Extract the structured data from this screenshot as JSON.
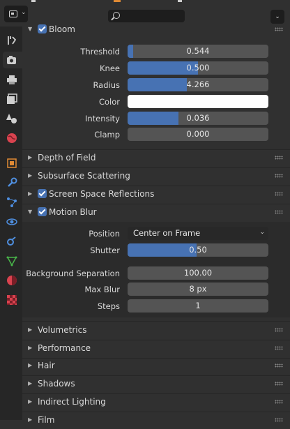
{
  "header": {
    "editor_type_icon": "properties-editor-icon",
    "search_icon": "search-icon"
  },
  "tabs": [
    {
      "name": "tool-tab",
      "icon": "wrench-screwdriver-icon",
      "color": "#cfcfcf"
    },
    {
      "name": "render-tab",
      "icon": "camera-back-icon",
      "color": "#cfcfcf",
      "active": true
    },
    {
      "name": "output-tab",
      "icon": "printer-icon",
      "color": "#cfcfcf"
    },
    {
      "name": "view-layer-tab",
      "icon": "image-stack-icon",
      "color": "#cfcfcf"
    },
    {
      "name": "scene-tab",
      "icon": "cone-sphere-icon",
      "color": "#cfcfcf"
    },
    {
      "name": "world-tab",
      "icon": "world-icon",
      "color": "#d9434f"
    },
    {
      "name": "object-tab",
      "icon": "square-object-icon",
      "color": "#e08a34"
    },
    {
      "name": "modifiers-tab",
      "icon": "wrench-icon",
      "color": "#4f8fe0"
    },
    {
      "name": "particles-tab",
      "icon": "particles-icon",
      "color": "#4f8fe0"
    },
    {
      "name": "physics-tab",
      "icon": "physics-orbit-icon",
      "color": "#4f8fe0"
    },
    {
      "name": "constraints-tab",
      "icon": "constraint-icon",
      "color": "#4f8fe0"
    },
    {
      "name": "data-tab",
      "icon": "triangle-mesh-icon",
      "color": "#49b54a"
    },
    {
      "name": "material-tab",
      "icon": "material-sphere-icon",
      "color": "#d9434f"
    },
    {
      "name": "texture-tab",
      "icon": "checker-texture-icon",
      "color": "#d9434f"
    }
  ],
  "bloom": {
    "title": "Bloom",
    "enabled": true,
    "fields": [
      {
        "label": "Threshold",
        "value": "0.544",
        "fill": 0.04
      },
      {
        "label": "Knee",
        "value": "0.500",
        "fill": 0.5
      },
      {
        "label": "Radius",
        "value": "4.266",
        "fill": 0.42
      },
      {
        "label": "Color",
        "value": "",
        "color": "#ffffff"
      },
      {
        "label": "Intensity",
        "value": "0.036",
        "fill": 0.36
      },
      {
        "label": "Clamp",
        "value": "0.000",
        "fill": 0
      }
    ]
  },
  "collapsed_panels_top": [
    {
      "title": "Depth of Field",
      "checkbox": false
    },
    {
      "title": "Subsurface Scattering",
      "checkbox": false
    },
    {
      "title": "Screen Space Reflections",
      "checkbox": true,
      "enabled": true
    }
  ],
  "motion_blur": {
    "title": "Motion Blur",
    "enabled": true,
    "position": {
      "label": "Position",
      "value": "Center on Frame"
    },
    "shutter": {
      "label": "Shutter",
      "value": "0.50",
      "fill": 0.5
    },
    "background_separation": {
      "label": "Background Separation",
      "value": "100.00"
    },
    "max_blur": {
      "label": "Max Blur",
      "value": "8 px"
    },
    "steps": {
      "label": "Steps",
      "value": "1"
    }
  },
  "collapsed_panels_bottom": [
    {
      "title": "Volumetrics"
    },
    {
      "title": "Performance"
    },
    {
      "title": "Hair"
    },
    {
      "title": "Shadows"
    },
    {
      "title": "Indirect Lighting"
    },
    {
      "title": "Film"
    }
  ],
  "colors": {
    "accent_blue": "#4772b3",
    "panel_bg": "#303030",
    "field_bg": "#545454"
  }
}
